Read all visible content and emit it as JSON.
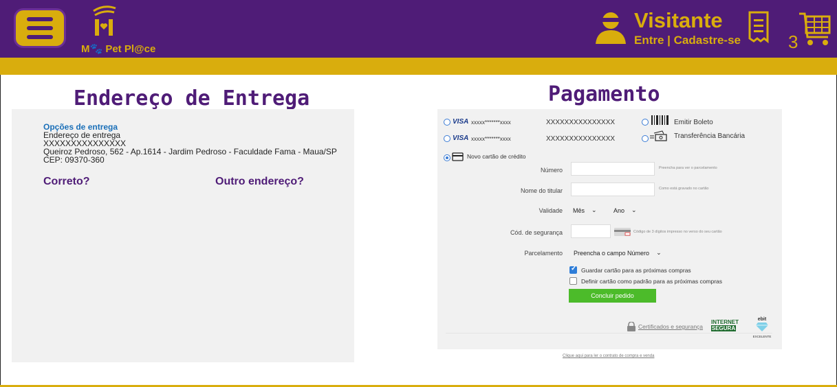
{
  "header": {
    "logo_text": "M🐾 Pet Pl@ce",
    "user_name": "Visitante",
    "user_links": "Entre | Cadastre-se",
    "cart_count": "3",
    "colors": {
      "purple": "#4f1c77",
      "gold": "#d9ad0d"
    }
  },
  "delivery": {
    "title": "Endereço de Entrega",
    "options_title": "Opções de entrega",
    "address_label": "Endereço de entrega",
    "recipient": "XXXXXXXXXXXXXXX",
    "street": "Queiroz Pedroso, 562 - Ap.1614 - Jardim Pedroso - Faculdade Fama - Maua/SP",
    "cep": "CEP: 09370-360",
    "correct_label": "Correto?",
    "other_label": "Outro endereço?"
  },
  "payment": {
    "title": "Pagamento",
    "saved_cards": [
      {
        "brand": "VISA",
        "masked": "xxxxx*******xxxx",
        "number": "XXXXXXXXXXXXXXX"
      },
      {
        "brand": "VISA",
        "masked": "xxxxx*******xxxx",
        "number": "XXXXXXXXXXXXXXX"
      }
    ],
    "boleto_label": "Emitir Boleto",
    "transfer_label": "Transferência Bancária",
    "new_card_label": "Novo cartão de crédito",
    "fields": {
      "number_label": "Número",
      "number_hint": "Preencha para ver o parcelamento",
      "holder_label": "Nome do titular",
      "holder_hint": "Como está gravado no cartão",
      "validity_label": "Validade",
      "month_value": "Mês",
      "year_value": "Ano",
      "cvv_label": "Cód. de segurança",
      "cvv_hint": "Código de 3 dígitos impresso no verso do seu cartão",
      "installments_label": "Parcelamento",
      "installments_value": "Preencha o campo Número"
    },
    "save_card_label": "Guardar cartão para as próximas compras",
    "save_card_checked": true,
    "default_card_label": "Definir cartão como padrão para as próximas compras",
    "default_card_checked": false,
    "submit_label": "Concluir pedido",
    "security_link": "Certificados e segurança",
    "badge_internet": "INTERNET",
    "badge_segura": "SEGURA",
    "badge_ebit": "ebit",
    "badge_excelente": "EXCELENTE",
    "contract_link": "Clique aqui para ler o contrato de compra e venda"
  }
}
